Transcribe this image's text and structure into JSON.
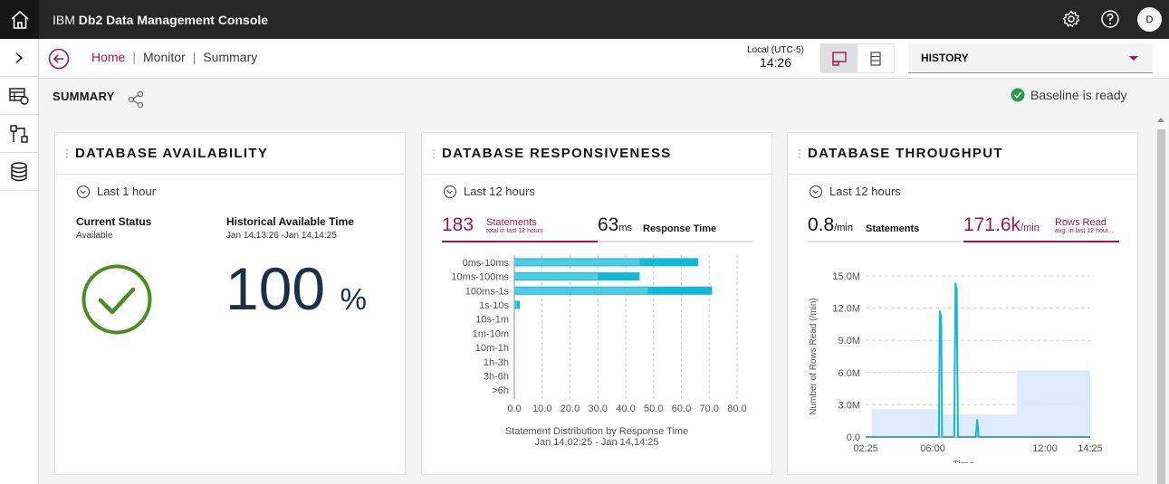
{
  "app": {
    "brand": "IBM",
    "product": "Db2 Data Management Console"
  },
  "topbar_icons": [
    "home-icon",
    "settings-icon",
    "help-icon"
  ],
  "user": {
    "initial": "D"
  },
  "breadcrumb": {
    "home": "Home",
    "monitor": "Monitor",
    "current": "Summary",
    "separator": "|"
  },
  "time": {
    "zone": "Local (UTC-5)",
    "value": "14:26"
  },
  "history": {
    "selected": "HISTORY"
  },
  "summary": {
    "title": "SUMMARY",
    "baseline": "Baseline is ready"
  },
  "colors": {
    "accent": "#9f1853",
    "teal": "#12b8d6",
    "green": "#4a8f1e",
    "dark": "#1d3049"
  },
  "availability": {
    "title": "DATABASE AVAILABILITY",
    "period": "Last 1 hour",
    "current_status_label": "Current Status",
    "current_status_value": "Available",
    "historical_label": "Historical Available Time",
    "historical_range": "Jan 14,13:26 -Jan 14,14:25",
    "percent_value": "100",
    "percent_symbol": "%"
  },
  "responsiveness": {
    "title": "DATABASE RESPONSIVENESS",
    "period": "Last 12 hours",
    "statements_value": "183",
    "statements_label": "Statements",
    "statements_sub": "total in last 12 hours",
    "response_value": "63",
    "response_unit": "ms",
    "response_label": "Response Time",
    "chart_caption": "Statement Distribution by Response Time",
    "chart_range": "Jan 14,02:25 - Jan 14,14:25"
  },
  "throughput": {
    "title": "DATABASE THROUGHPUT",
    "period": "Last 12 hours",
    "statements_value": "0.8",
    "statements_unit": "/min",
    "statements_label": "Statements",
    "rows_value": "171.6k",
    "rows_unit": "/min",
    "rows_label": "Rows Read",
    "rows_sub": "avg. in last 12 hour..."
  },
  "chart_data": [
    {
      "type": "bar",
      "orientation": "horizontal",
      "categories": [
        "0ms-10ms",
        "10ms-100ms",
        "100ms-1s",
        "1s-10s",
        "10s-1m",
        "1m-10m",
        "10m-1h",
        "1h-3h",
        "3h-6h",
        ">6h"
      ],
      "series": [
        {
          "values": [
            66,
            45,
            71,
            2,
            0,
            0,
            0,
            0,
            0,
            0
          ]
        },
        {
          "values": [
            45,
            30,
            48,
            1,
            0,
            0,
            0,
            0,
            0,
            0
          ]
        }
      ],
      "xlim": [
        0,
        80
      ],
      "x_ticks": [
        "0.0",
        "10.0",
        "20.0",
        "30.0",
        "40.0",
        "50.0",
        "60.0",
        "70.0",
        "80.0"
      ],
      "xlabel": "Statement Distribution by Response Time",
      "grid": true
    },
    {
      "type": "line",
      "ylabel": "Number of Rows Read (/min)",
      "xlabel": "Time",
      "ylim": [
        0,
        15000000
      ],
      "y_ticks": [
        "0.0",
        "3.0M",
        "6.0M",
        "9.0M",
        "12.0M",
        "15.0M"
      ],
      "x_ticks": [
        "02:25",
        "06:00",
        "12:00",
        "14:25"
      ],
      "x_tick_hours": [
        2.4167,
        6.0,
        12.0,
        14.4167
      ],
      "series": [
        {
          "style": "line",
          "x": [
            2.42,
            6.33,
            6.38,
            6.45,
            6.5,
            7.15,
            7.22,
            7.28,
            7.35,
            8.3,
            8.38,
            8.45,
            14.42
          ],
          "y": [
            0,
            0,
            11700000,
            11200000,
            0,
            0,
            14300000,
            13800000,
            0,
            0,
            1600000,
            0,
            0
          ]
        },
        {
          "style": "area",
          "x": [
            2.75,
            6.5,
            6.5,
            10.5,
            10.5,
            14.42
          ],
          "y": [
            2600000,
            2600000,
            2100000,
            2100000,
            6200000,
            6200000
          ]
        }
      ],
      "grid": true
    }
  ]
}
